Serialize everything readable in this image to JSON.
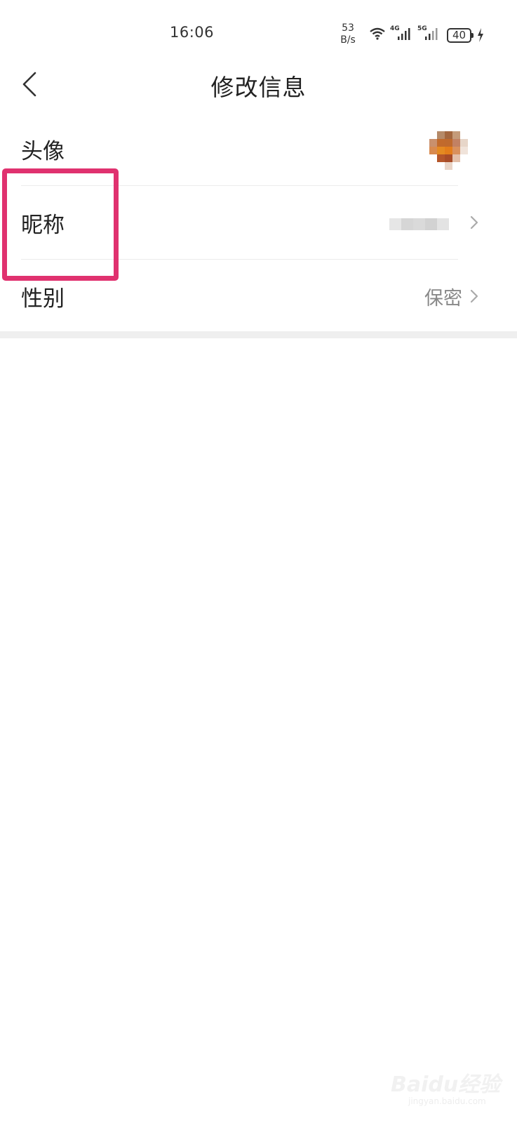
{
  "status_bar": {
    "time": "16:06",
    "net_speed_value": "53",
    "net_speed_unit": "B/s",
    "signal_1_label": "4G",
    "signal_2_label": "5G",
    "battery": "40"
  },
  "header": {
    "title": "修改信息",
    "back_icon": "chevron-left-icon"
  },
  "profile_items": [
    {
      "label": "头像",
      "value": ""
    },
    {
      "label": "昵称",
      "value": ""
    },
    {
      "label": "性别",
      "value": "保密"
    }
  ],
  "colors": {
    "highlight_box": "#e0316f",
    "value_text": "#888888",
    "divider": "#ececec"
  },
  "watermark": {
    "brand": "Baidu经验",
    "url": "jingyan.baidu.com"
  }
}
